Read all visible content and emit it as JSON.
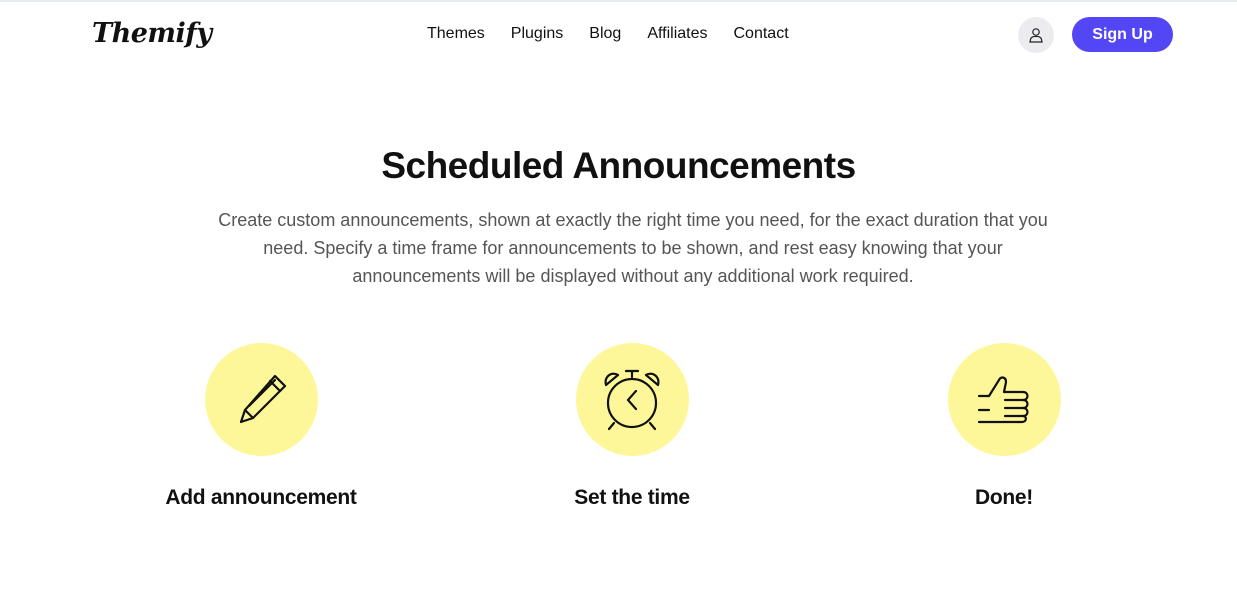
{
  "header": {
    "logo": "Themify",
    "nav": [
      {
        "label": "Themes"
      },
      {
        "label": "Plugins"
      },
      {
        "label": "Blog"
      },
      {
        "label": "Affiliates"
      },
      {
        "label": "Contact"
      }
    ],
    "account_icon": "user-icon",
    "signup_label": "Sign Up"
  },
  "hero": {
    "title": "Scheduled Announcements",
    "description": "Create custom announcements, shown at exactly the right time you need, for the exact duration that you need. Specify a time frame for announcements to be shown, and rest easy knowing that your announcements will be displayed without any additional work required."
  },
  "steps": [
    {
      "icon": "pencil-icon",
      "label": "Add announcement"
    },
    {
      "icon": "alarm-clock-icon",
      "label": "Set the time"
    },
    {
      "icon": "thumbs-up-icon",
      "label": "Done!"
    }
  ],
  "colors": {
    "accent": "#5246f5",
    "icon_circle": "#fef79a",
    "text": "#111111",
    "muted_text": "#555555"
  }
}
